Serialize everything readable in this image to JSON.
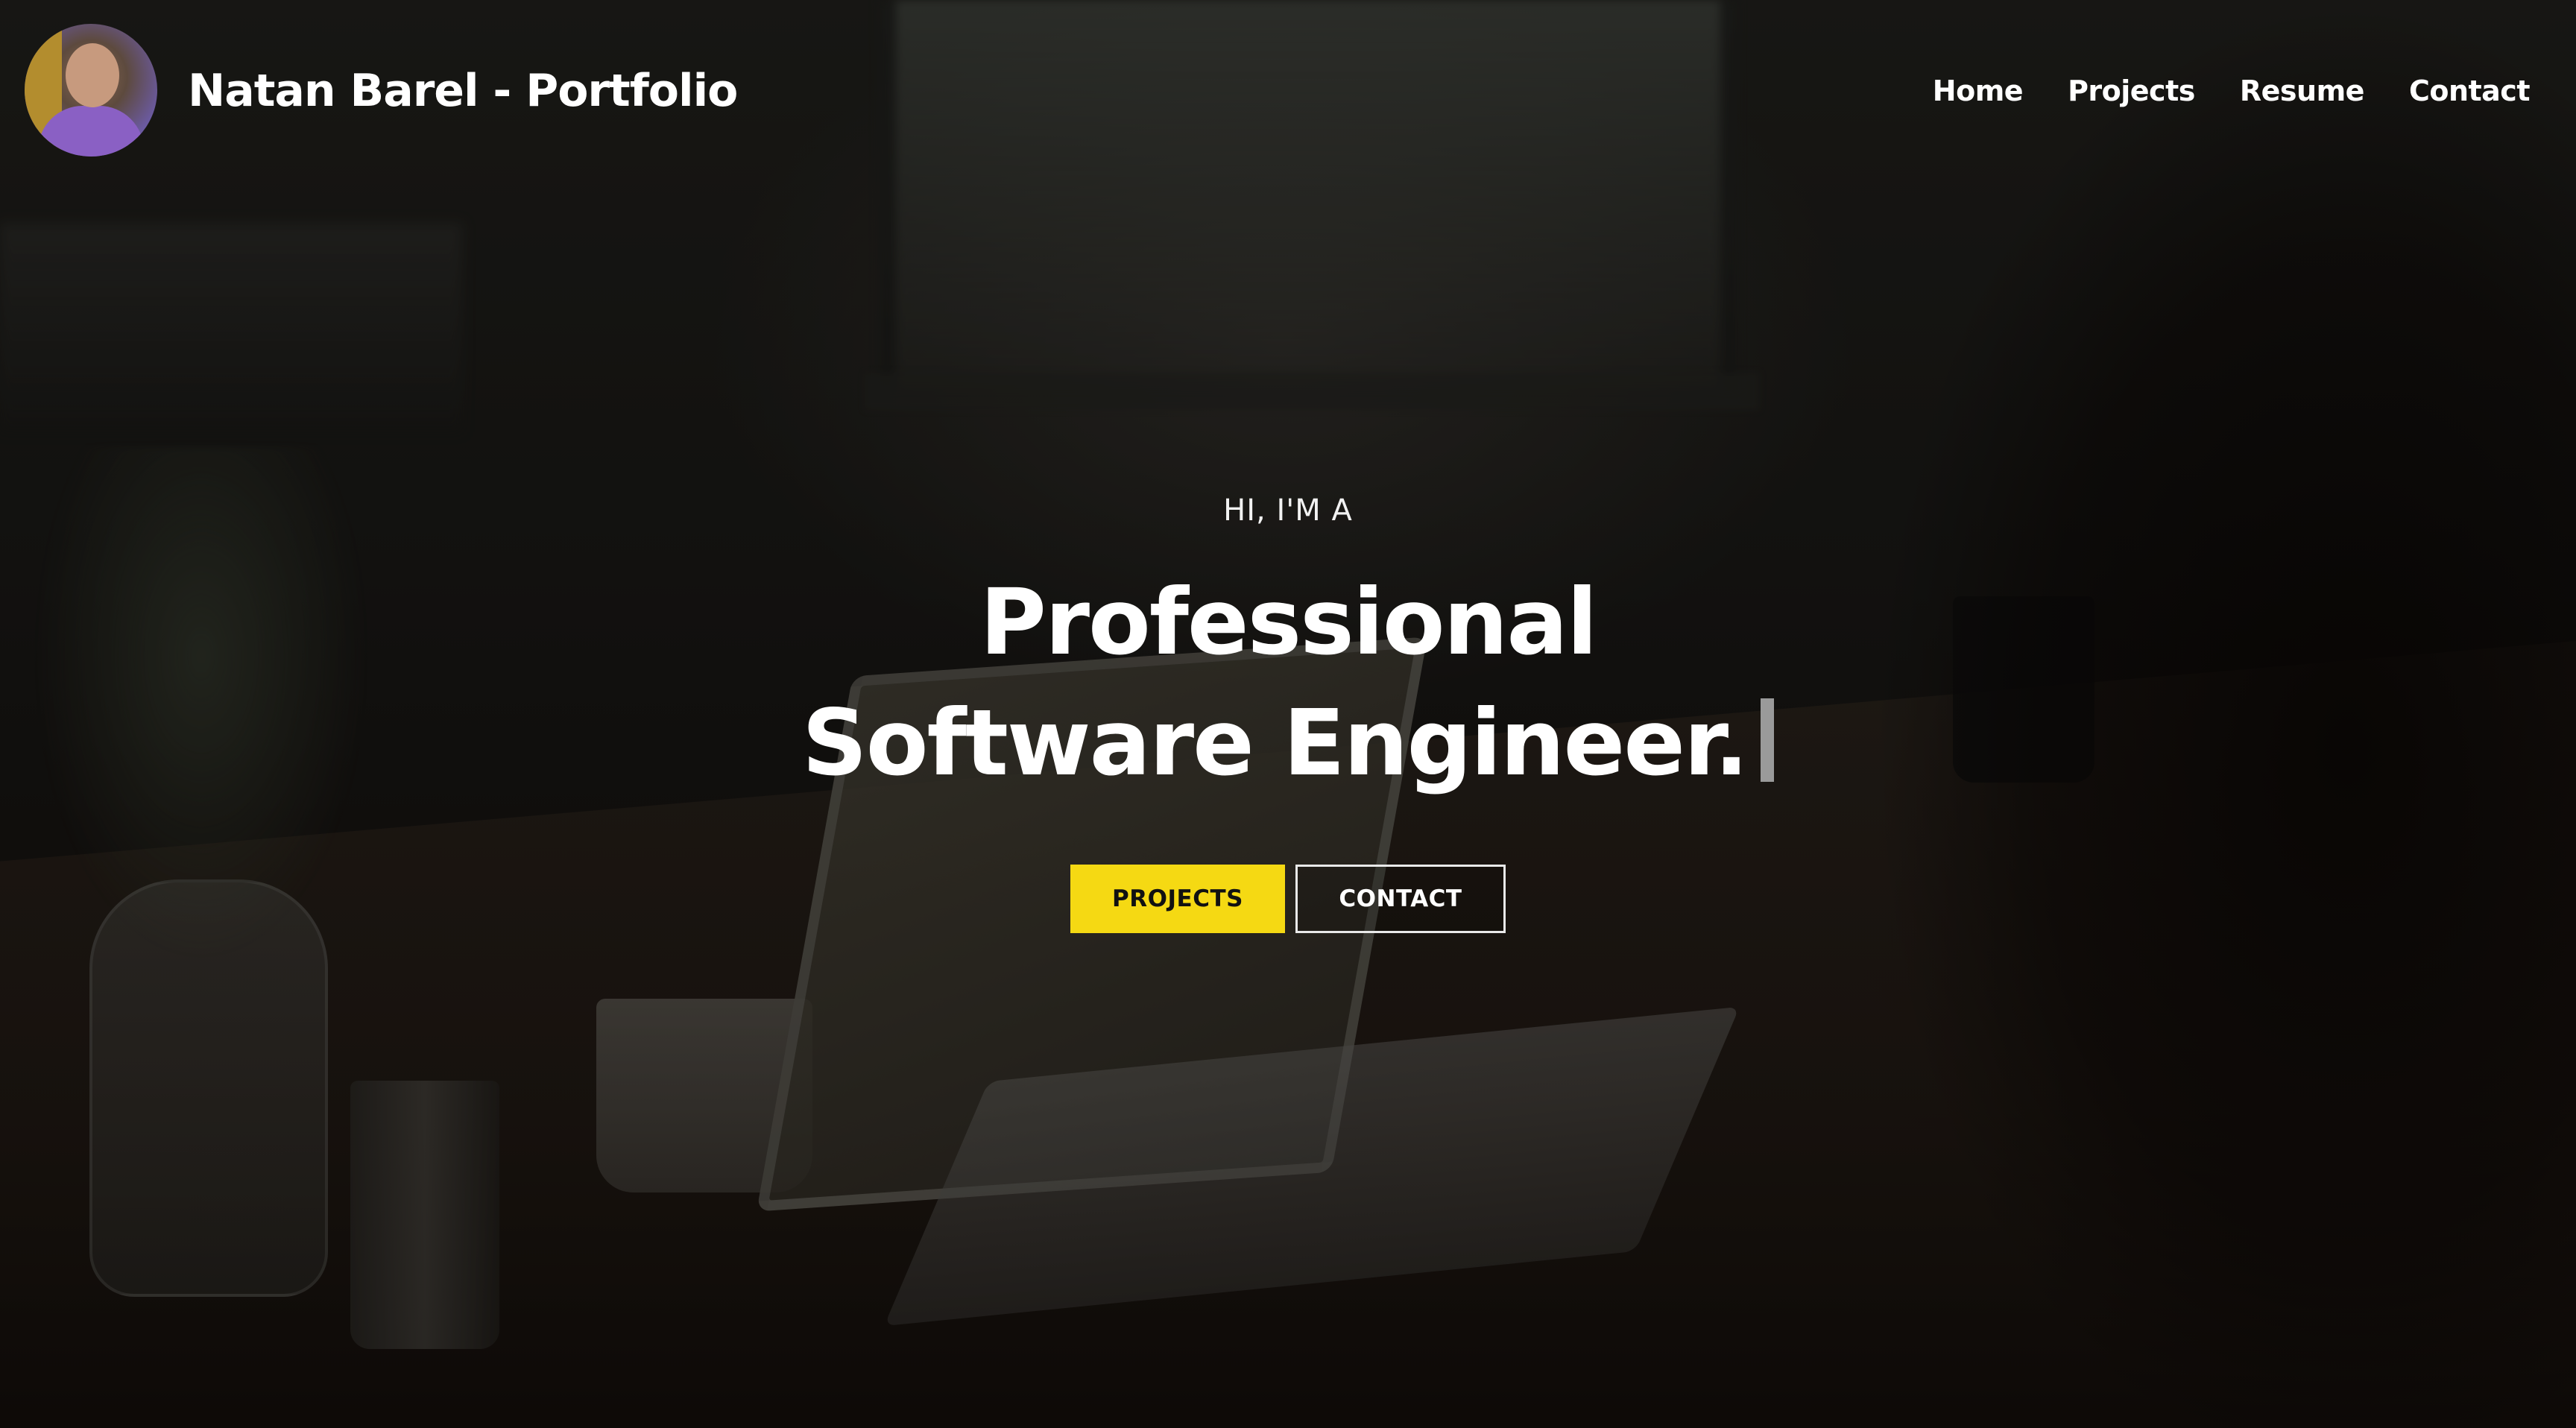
{
  "header": {
    "title": "Natan Barel - Portfolio",
    "nav": [
      {
        "label": "Home"
      },
      {
        "label": "Projects"
      },
      {
        "label": "Resume"
      },
      {
        "label": "Contact"
      }
    ]
  },
  "hero": {
    "eyebrow": "HI, I'M A",
    "heading": "Professional Software Engineer.",
    "buttons": {
      "projects": "PROJECTS",
      "contact": "CONTACT"
    }
  },
  "colors": {
    "accent": "#f5d913",
    "text": "#ffffff",
    "overlay": "#000000"
  },
  "icons": {
    "avatar": "profile-photo",
    "cursor": "typing-cursor"
  }
}
